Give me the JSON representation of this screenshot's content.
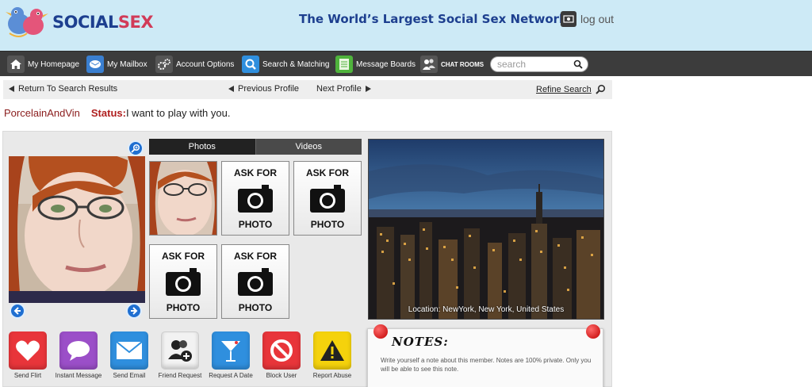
{
  "header": {
    "logo_part1": "SOCIAL",
    "logo_part2": "SEX",
    "tagline": "The World’s Largest Social Sex Network",
    "logout_label": "log out"
  },
  "nav": {
    "items": [
      {
        "label": "My Homepage",
        "icon": "home-icon"
      },
      {
        "label": "My Mailbox",
        "icon": "mailbox-icon"
      },
      {
        "label": "Account Options",
        "icon": "gears-icon"
      },
      {
        "label": "Search & Matching",
        "icon": "magnifier-icon"
      },
      {
        "label": "Message Boards",
        "icon": "message-board-icon"
      },
      {
        "label": "CHAT ROOMS",
        "icon": "chat-rooms-icon"
      }
    ],
    "search_placeholder": "search"
  },
  "results_bar": {
    "return_label": "Return To Search Results",
    "previous_label": "Previous Profile",
    "next_label": "Next Profile",
    "refine_label": "Refine Search"
  },
  "profile": {
    "username": "PorcelainAndVin",
    "status_label": "Status:",
    "status_text": "I want to play with you."
  },
  "media_tabs": {
    "photos": "Photos",
    "videos": "Videos"
  },
  "ask_for_photo": {
    "top": "ASK FOR",
    "bottom": "PHOTO"
  },
  "location_text": "Location: NewYork, New York, United States",
  "actions": [
    {
      "label": "Send Flirt",
      "icon": "heart-icon",
      "color": "#e8353a"
    },
    {
      "label": "Instant Message",
      "icon": "speech-bubble-icon",
      "color": "#9b4fc8"
    },
    {
      "label": "Send Email",
      "icon": "envelope-icon",
      "color": "#2f8fde"
    },
    {
      "label": "Friend Request",
      "icon": "add-friend-icon",
      "color": "#f2f2f2"
    },
    {
      "label": "Request A Date",
      "icon": "cocktail-icon",
      "color": "#2f8fde"
    },
    {
      "label": "Block User",
      "icon": "block-icon",
      "color": "#e8353a"
    },
    {
      "label": "Report Abuse",
      "icon": "warning-icon",
      "color": "#f5d20c"
    }
  ],
  "notes": {
    "title": "NOTES:",
    "text": "Write yourself a note about this member. Notes are 100% private. Only you will be able to see this note."
  }
}
